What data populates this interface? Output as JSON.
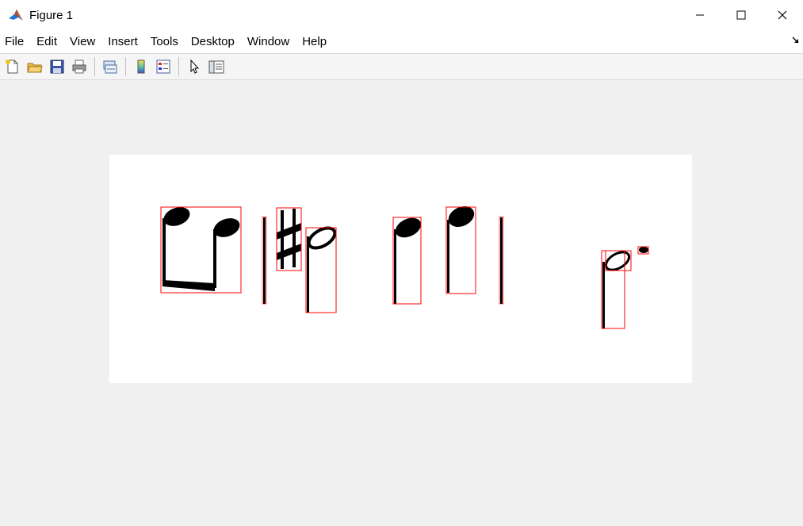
{
  "window": {
    "title": "Figure 1",
    "controls": [
      "minimize",
      "maximize",
      "close"
    ]
  },
  "menu": {
    "items": [
      "File",
      "Edit",
      "View",
      "Insert",
      "Tools",
      "Desktop",
      "Window",
      "Help"
    ]
  },
  "toolbar": {
    "buttons": [
      {
        "icon": "new-figure-icon"
      },
      {
        "icon": "open-file-icon"
      },
      {
        "icon": "save-icon"
      },
      {
        "icon": "print-icon"
      },
      {
        "icon": "link-plot-icon"
      },
      {
        "icon": "insert-colorbar-icon"
      },
      {
        "icon": "insert-legend-icon"
      },
      {
        "icon": "edit-plot-arrow-icon"
      },
      {
        "icon": "property-inspector-icon"
      }
    ]
  },
  "figure": {
    "background": "#ffffff",
    "box_color": "#ff0000",
    "ink_color": "#000000",
    "content": "binarized music notation image with red bounding boxes around detected symbols"
  }
}
